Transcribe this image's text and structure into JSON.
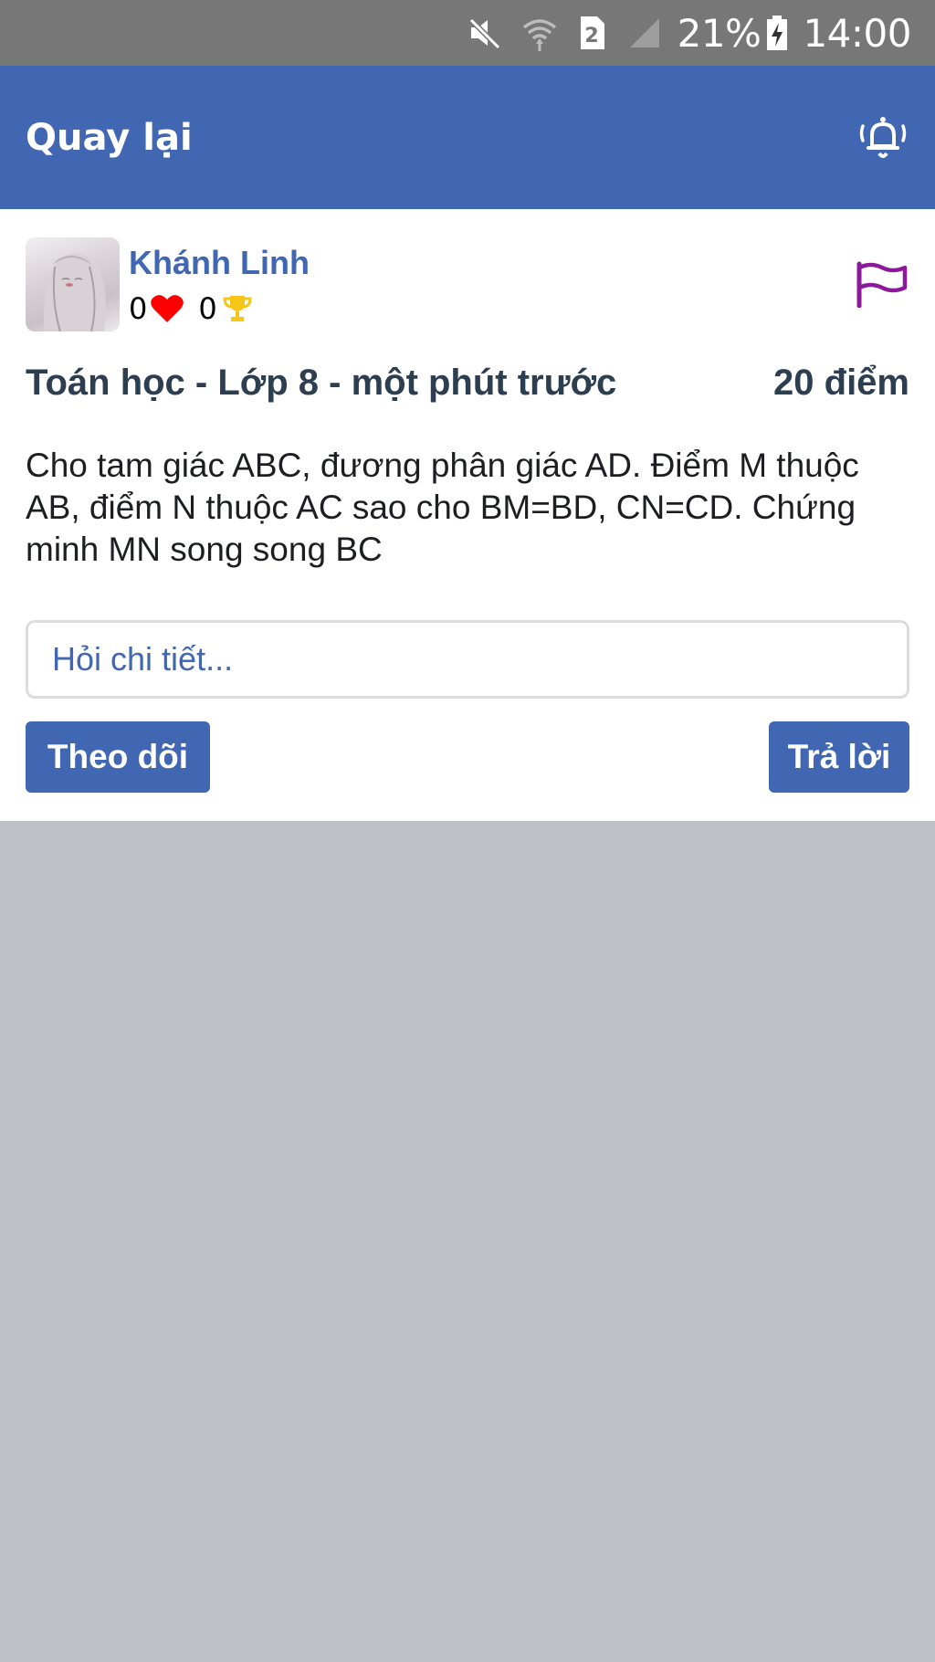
{
  "status_bar": {
    "battery": "21%",
    "time": "14:00",
    "sim_slot": "2"
  },
  "app_bar": {
    "back_label": "Quay lại",
    "notification_icon": "bell-icon"
  },
  "question": {
    "author": "Khánh Linh",
    "likes": "0",
    "trophies": "0",
    "meta": "Toán học - Lớp 8 - một phút trước",
    "points": "20 điểm",
    "text": "Cho tam giác ABC, đương phân giác AD. Điểm M thuộc AB, điểm N thuộc AC sao cho BM=BD, CN=CD. Chứng minh MN song song BC",
    "detail_placeholder": "Hỏi chi tiết...",
    "detail_value": "",
    "follow_label": "Theo dõi",
    "answer_label": "Trả lời"
  },
  "colors": {
    "primary": "#4267b2",
    "status_bar": "#777777",
    "page_bg": "#bdc1c6",
    "heart": "#ff0000",
    "trophy": "#f5c518",
    "flag": "#8b1a9b",
    "meta_text": "#2c3e50"
  }
}
